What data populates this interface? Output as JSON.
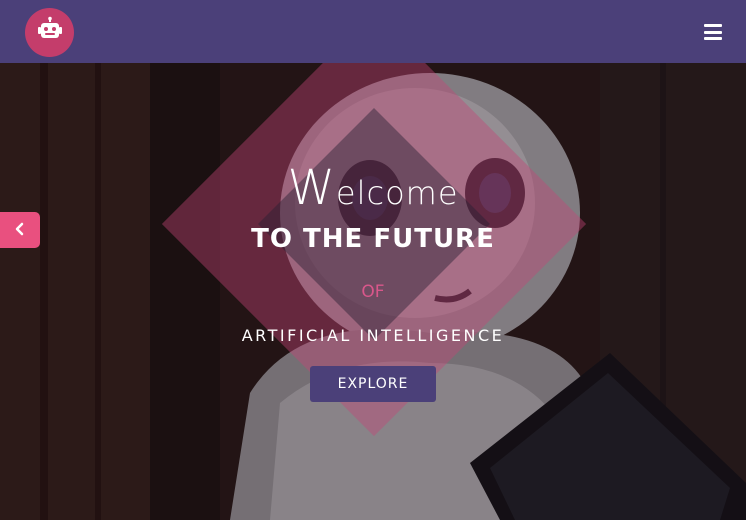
{
  "navbar": {
    "logo_icon": "robot-icon",
    "menu_icon": "hamburger-menu-icon",
    "background": "#4b4079",
    "logo_color": "#c43d6b"
  },
  "hero": {
    "welcome_first_letter": "W",
    "welcome_rest": "elcome",
    "headline": "TO THE FUTURE",
    "connector": "OF",
    "subtitle": "ARTIFICIAL INTELLIGENCE",
    "cta_label": "EXPLORE",
    "prev_icon": "chevron-left-icon",
    "accent_color": "#e9507f",
    "connector_color": "#d9578b"
  }
}
